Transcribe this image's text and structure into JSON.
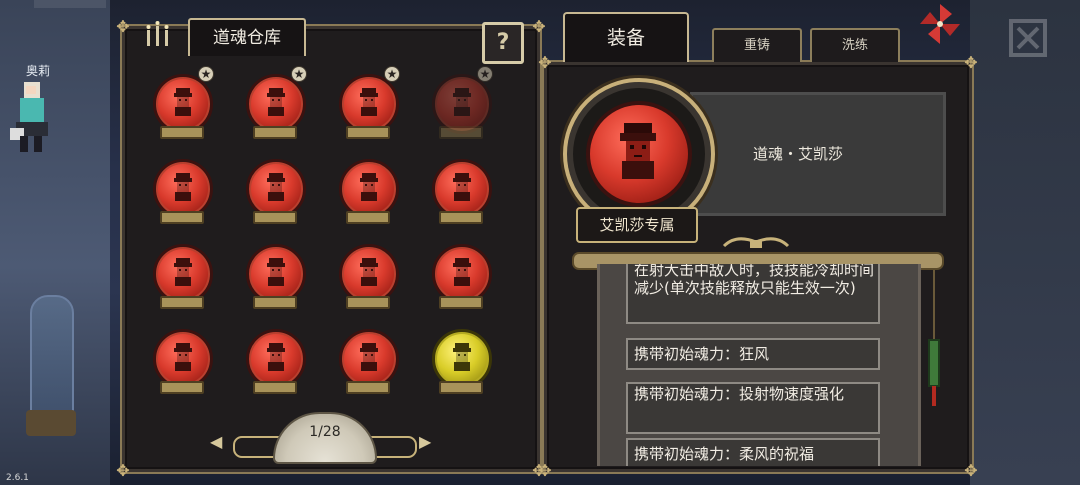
{
  "left_panel": {
    "tab_label": "道魂仓库",
    "help_label": "?",
    "grid": [
      {
        "state": "normal",
        "star": true
      },
      {
        "state": "normal",
        "star": true
      },
      {
        "state": "normal",
        "star": true
      },
      {
        "state": "dim",
        "star": true
      },
      {
        "state": "normal",
        "star": false
      },
      {
        "state": "normal",
        "star": false
      },
      {
        "state": "normal",
        "star": false
      },
      {
        "state": "normal",
        "star": false
      },
      {
        "state": "normal",
        "star": false
      },
      {
        "state": "normal",
        "star": false
      },
      {
        "state": "normal",
        "star": false
      },
      {
        "state": "normal",
        "star": false
      },
      {
        "state": "normal",
        "star": false
      },
      {
        "state": "normal",
        "star": false
      },
      {
        "state": "normal",
        "star": false
      },
      {
        "state": "gold",
        "star": false
      }
    ],
    "pager": {
      "page_text": "1/28",
      "prev_icon": "arrow-left-icon",
      "next_icon": "arrow-right-icon"
    }
  },
  "right_panel": {
    "tabs": {
      "equip": "装备",
      "recast": "重铸",
      "refine": "洗练"
    },
    "item_name": "道魂・艾凯莎",
    "exclusive_label": "艾凯莎专属",
    "affixes": [
      "在射大击中敌人时，技技能冷却时间减少(单次技能释放只能生效一次)",
      "携带初始魂力：狂风",
      "携带初始魂力：投射物速度强化",
      "携带初始魂力：柔风的祝福"
    ]
  },
  "scene": {
    "npc_name": "奥莉",
    "version": "2.6.1"
  },
  "colors": {
    "orb_red": "#d93a2c",
    "orb_gold": "#d9cd28",
    "frame_gold": "#c7b892",
    "panel_bg": "#1f1c1d"
  }
}
